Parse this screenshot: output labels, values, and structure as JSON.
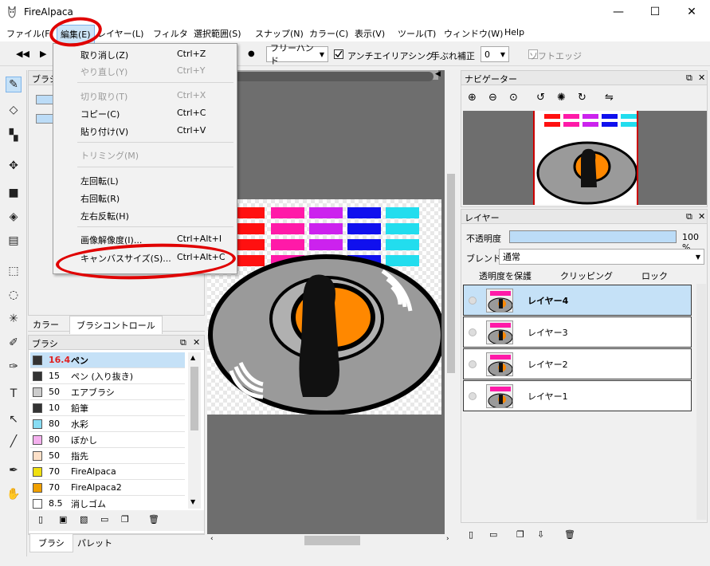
{
  "window": {
    "title": "FireAlpaca",
    "minimize": "—",
    "maximize": "☐",
    "close": "✕"
  },
  "menubar": [
    "ファイル(F)",
    "編集(E)",
    "レイヤー(L)",
    "フィルタ",
    "選択範囲(S)",
    "スナップ(N)",
    "カラー(C)",
    "表示(V)",
    "ツール(T)",
    "ウィンドウ(W)",
    "Help"
  ],
  "toolbar": {
    "mode": "フリーハンド",
    "antialias_label": "アンチエイリアシング",
    "antialias_checked": true,
    "stabilizer_label": "手ぶれ補正",
    "stabilizer_value": "0",
    "soft_edge_label": "ソフトエッジ"
  },
  "edit_menu": {
    "items": [
      {
        "label": "取り消し(Z)",
        "shortcut": "Ctrl+Z",
        "enabled": true
      },
      {
        "label": "やり直し(Y)",
        "shortcut": "Ctrl+Y",
        "enabled": false
      },
      {
        "label": "切り取り(T)",
        "shortcut": "Ctrl+X",
        "enabled": false
      },
      {
        "label": "コピー(C)",
        "shortcut": "Ctrl+C",
        "enabled": true
      },
      {
        "label": "貼り付け(V)",
        "shortcut": "Ctrl+V",
        "enabled": true
      },
      {
        "label": "トリミング(M)",
        "shortcut": "",
        "enabled": false
      },
      {
        "label": "左回転(L)",
        "shortcut": "",
        "enabled": true
      },
      {
        "label": "右回転(R)",
        "shortcut": "",
        "enabled": true
      },
      {
        "label": "左右反転(H)",
        "shortcut": "",
        "enabled": true
      },
      {
        "label": "画像解像度(I)...",
        "shortcut": "Ctrl+Alt+I",
        "enabled": true
      },
      {
        "label": "キャンバスサイズ(S)...",
        "shortcut": "Ctrl+Alt+C",
        "enabled": true
      }
    ]
  },
  "left_panel": {
    "brush_tab_title": "ブラシ",
    "color_tabs": [
      "カラー",
      "ブラシコントロール"
    ],
    "brush_panel_title": "ブラシ",
    "brushes": [
      {
        "size": "16.4",
        "name": "ペン",
        "color": "#333333",
        "selected": true
      },
      {
        "size": "15",
        "name": "ペン (入り抜き)",
        "color": "#333333",
        "selected": false
      },
      {
        "size": "50",
        "name": "エアブラシ",
        "color": "#cccccc",
        "selected": false
      },
      {
        "size": "10",
        "name": "鉛筆",
        "color": "#333333",
        "selected": false
      },
      {
        "size": "80",
        "name": "水彩",
        "color": "#88ddf4",
        "selected": false
      },
      {
        "size": "80",
        "name": "ぼかし",
        "color": "#f4b0ee",
        "selected": false
      },
      {
        "size": "50",
        "name": "指先",
        "color": "#fde0c8",
        "selected": false
      },
      {
        "size": "70",
        "name": "FireAlpaca",
        "color": "#f0e010",
        "selected": false
      },
      {
        "size": "70",
        "name": "FireAlpaca2",
        "color": "#f0a000",
        "selected": false
      },
      {
        "size": "8.5",
        "name": "消しゴム",
        "color": "#ffffff",
        "selected": false
      }
    ],
    "bottom_tabs": [
      "ブラシ",
      "パレット"
    ]
  },
  "navigator": {
    "title": "ナビゲーター"
  },
  "layers_panel": {
    "title": "レイヤー",
    "opacity_label": "不透明度",
    "opacity_value": "100 %",
    "opacity_fraction": 1.0,
    "blend_label": "ブレンド",
    "blend_value": "通常",
    "protect_label": "透明度を保護",
    "clipping_label": "クリッピング",
    "lock_label": "ロック",
    "layers": [
      {
        "name": "レイヤー4",
        "selected": true
      },
      {
        "name": "レイヤー3",
        "selected": false
      },
      {
        "name": "レイヤー2",
        "selected": false
      },
      {
        "name": "レイヤー1",
        "selected": false
      }
    ]
  },
  "colors": {
    "accent_selected": "#c5e1f7",
    "annotation": "#e00000",
    "canvas_bg": "#6e6e6e"
  }
}
